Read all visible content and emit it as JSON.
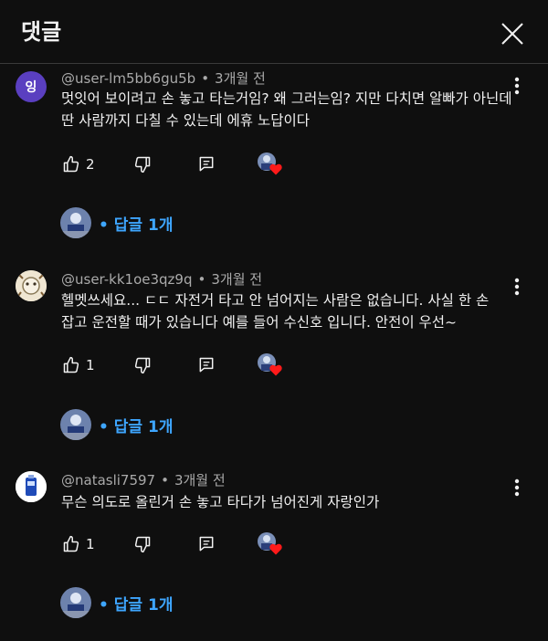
{
  "header": {
    "title": "댓글"
  },
  "comments": [
    {
      "avatar_letter": "잉",
      "author": "@user-lm5bb6gu5b",
      "time": "3개월 전",
      "text": "멋잇어 보이려고 손 놓고 타는거임? 왜 그러는임? 지만 다치면 알빠가 아닌데 딴 사람까지 다칠 수 있는데 에휴 노답이다",
      "likes": "2",
      "replies_label": "답글 1개"
    },
    {
      "avatar_letter": "",
      "author": "@user-kk1oe3qz9q",
      "time": "3개월 전",
      "text": "헬멧쓰세요... ㄷㄷ 자전거 타고 안 넘어지는 사람은 없습니다. 사실 한 손 잡고 운전할 때가 있습니다 예를 들어 수신호 입니다. 안전이 우선~",
      "likes": "1",
      "replies_label": "답글 1개"
    },
    {
      "avatar_letter": "",
      "author": "@natasli7597",
      "time": "3개월 전",
      "text": "무슨 의도로 올린거 손 놓고 타다가 넘어진게 자랑인가",
      "likes": "1",
      "replies_label": "답글 1개"
    }
  ],
  "colors": {
    "background": "#0f0f0f",
    "text": "#f1f1f1",
    "meta": "#aaaaaa",
    "link": "#3ea6ff",
    "heart": "#ff1a1a",
    "avatar_purple": "#5a3fc0"
  },
  "icons": {
    "close": "close-icon",
    "like": "thumb-up-icon",
    "dislike": "thumb-down-icon",
    "reply": "reply-icon",
    "more": "more-vertical-icon",
    "creator_heart": "creator-heart-icon"
  }
}
